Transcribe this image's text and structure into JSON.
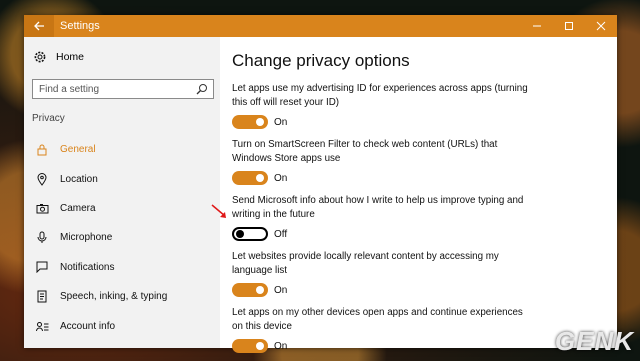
{
  "window": {
    "title": "Settings",
    "controls": {
      "minimize": "minimize-icon",
      "maximize": "maximize-icon",
      "close": "close-icon"
    },
    "accent": "#d9841c"
  },
  "sidebar": {
    "home_label": "Home",
    "search_placeholder": "Find a setting",
    "section": "Privacy",
    "items": [
      {
        "label": "General",
        "icon": "lock-icon",
        "active": true
      },
      {
        "label": "Location",
        "icon": "location-icon",
        "active": false
      },
      {
        "label": "Camera",
        "icon": "camera-icon",
        "active": false
      },
      {
        "label": "Microphone",
        "icon": "microphone-icon",
        "active": false
      },
      {
        "label": "Notifications",
        "icon": "notifications-icon",
        "active": false
      },
      {
        "label": "Speech, inking, & typing",
        "icon": "speech-icon",
        "active": false
      },
      {
        "label": "Account info",
        "icon": "account-info-icon",
        "active": false
      }
    ]
  },
  "main": {
    "title": "Change privacy options",
    "settings": [
      {
        "description": "Let apps use my advertising ID for experiences across apps (turning this off will reset your ID)",
        "state": "On"
      },
      {
        "description": "Turn on SmartScreen Filter to check web content (URLs) that Windows Store apps use",
        "state": "On"
      },
      {
        "description": "Send Microsoft info about how I write to help us improve typing and writing in the future",
        "state": "Off"
      },
      {
        "description": "Let websites provide locally relevant content by accessing my language list",
        "state": "On"
      },
      {
        "description": "Let apps on my other devices open apps and continue experiences on this device",
        "state": "On"
      }
    ]
  },
  "watermark": "GENK"
}
